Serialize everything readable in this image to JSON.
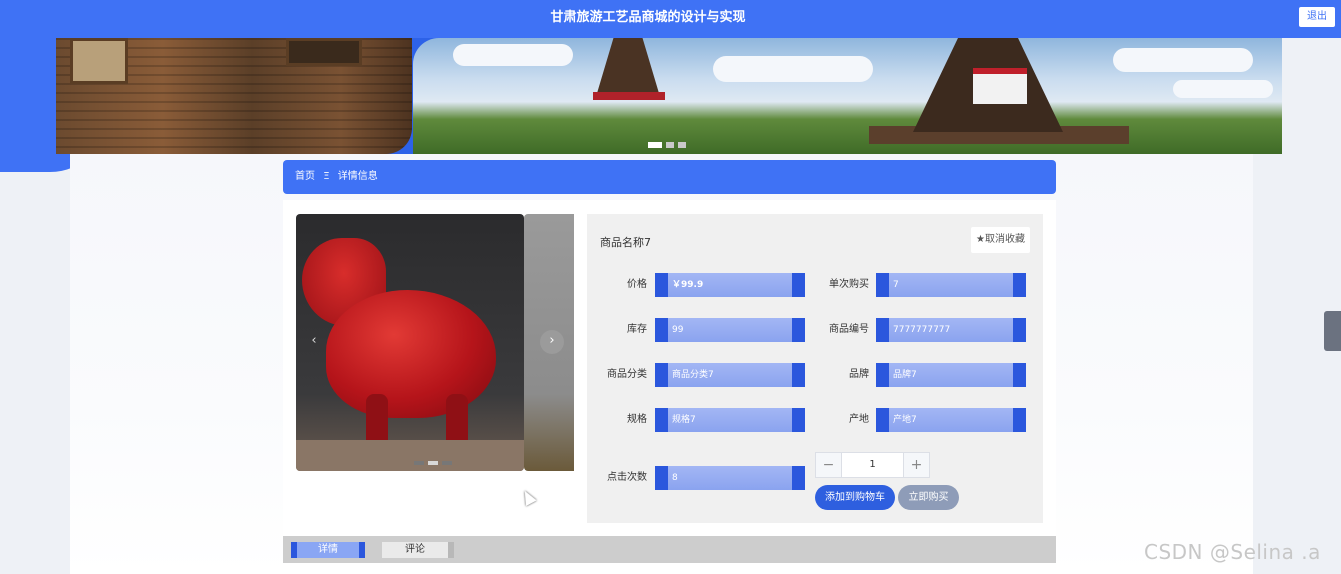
{
  "header": {
    "title": "甘肃旅游工艺品商城的设计与实现",
    "logout_label": "退出"
  },
  "breadcrumb": {
    "home": "首页",
    "separator": "Ξ",
    "current": "详情信息"
  },
  "product": {
    "name": "商品名称7",
    "favorite_label": "★取消收藏",
    "fields": {
      "price": {
        "label": "价格",
        "value": "￥99.9"
      },
      "per_purchase": {
        "label": "单次购买",
        "value": "7"
      },
      "stock": {
        "label": "库存",
        "value": "99"
      },
      "code": {
        "label": "商品编号",
        "value": "7777777777"
      },
      "category": {
        "label": "商品分类",
        "value": "商品分类7"
      },
      "brand": {
        "label": "品牌",
        "value": "品牌7"
      },
      "spec": {
        "label": "规格",
        "value": "规格7"
      },
      "origin": {
        "label": "产地",
        "value": "产地7"
      },
      "clicks": {
        "label": "点击次数",
        "value": "8"
      }
    },
    "quantity": "1",
    "add_to_cart_label": "添加到购物车",
    "buy_now_label": "立即购买"
  },
  "tabs": [
    {
      "label": "详情"
    },
    {
      "label": "评论"
    }
  ],
  "watermark": "CSDN @Selina .a",
  "colors": {
    "primary": "#3f72f5",
    "field_accent": "#2b57dd",
    "field_fill": "#8aa3ef",
    "buy_button": "#8e9cb8"
  }
}
